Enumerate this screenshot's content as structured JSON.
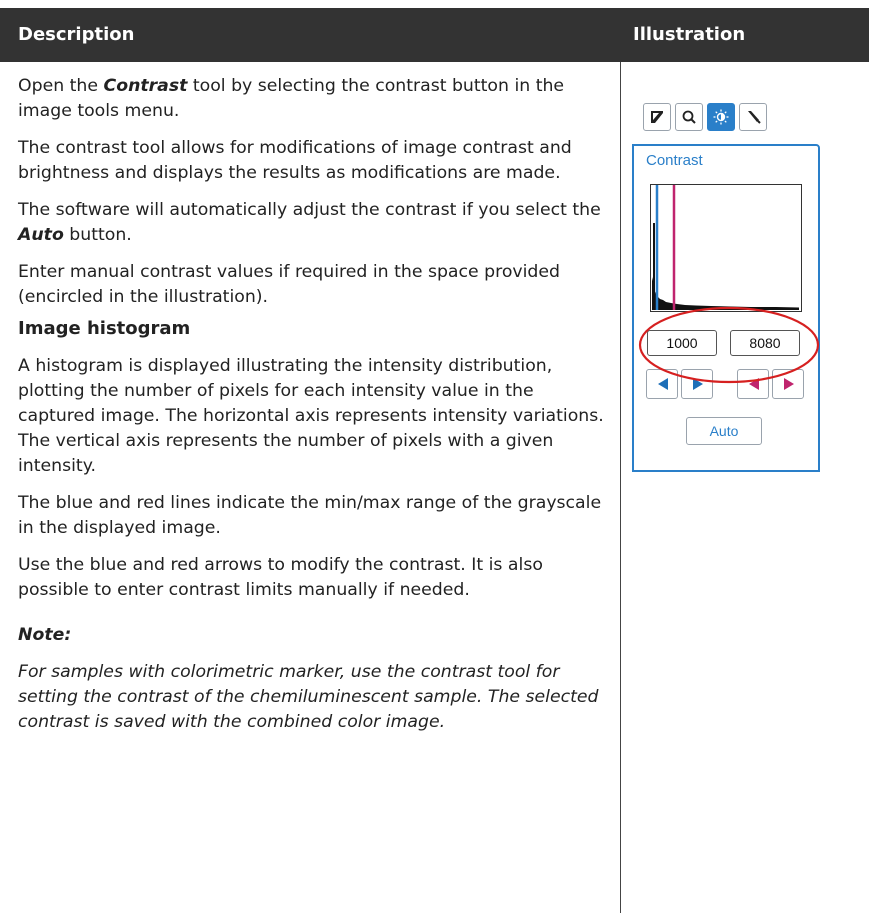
{
  "header": {
    "description_label": "Description",
    "illustration_label": "Illustration"
  },
  "description": {
    "p1_pre": "Open the ",
    "p1_highlight": "Contrast",
    "p1_post": " tool by selecting the contrast button in the image tools menu.",
    "p2": "The contrast tool allows for modifications of image contrast and brightness and displays the results as modifications are made.",
    "p3_pre": "The software will automatically adjust the contrast if you select the ",
    "p3_highlight": "Auto",
    "p3_post": " button.",
    "p4": "Enter manual contrast values if required in the space provided (encircled in the illustration).",
    "subheading": "Image histogram",
    "p5": "A histogram is displayed illustrating the intensity distribution, plotting the number of pixels for each intensity value in the captured image. The horizontal axis represents intensity variations. The vertical axis represents the number of pixels with a given intensity.",
    "p6": "The blue and red lines indicate the min/max range of the grayscale in the displayed image.",
    "p7": "Use the blue and red arrows to modify the contrast. It is also possible to enter contrast limits manually if needed.",
    "note_title": "Note:",
    "note_body": "For samples with colorimetric marker, use the contrast tool for setting the contrast of the chemiluminescent sample. The selected contrast is saved with the combined color image."
  },
  "illustration": {
    "panel_title": "Contrast",
    "min_value": "1000",
    "max_value": "8080",
    "auto_label": "Auto",
    "accent_color": "#2a7fc9",
    "min_line_color": "#2a7fc9",
    "max_line_color": "#c0246e",
    "circle_color": "#d62020",
    "tools": [
      "crop-icon",
      "search-icon",
      "contrast-icon",
      "eyedropper-icon"
    ]
  }
}
